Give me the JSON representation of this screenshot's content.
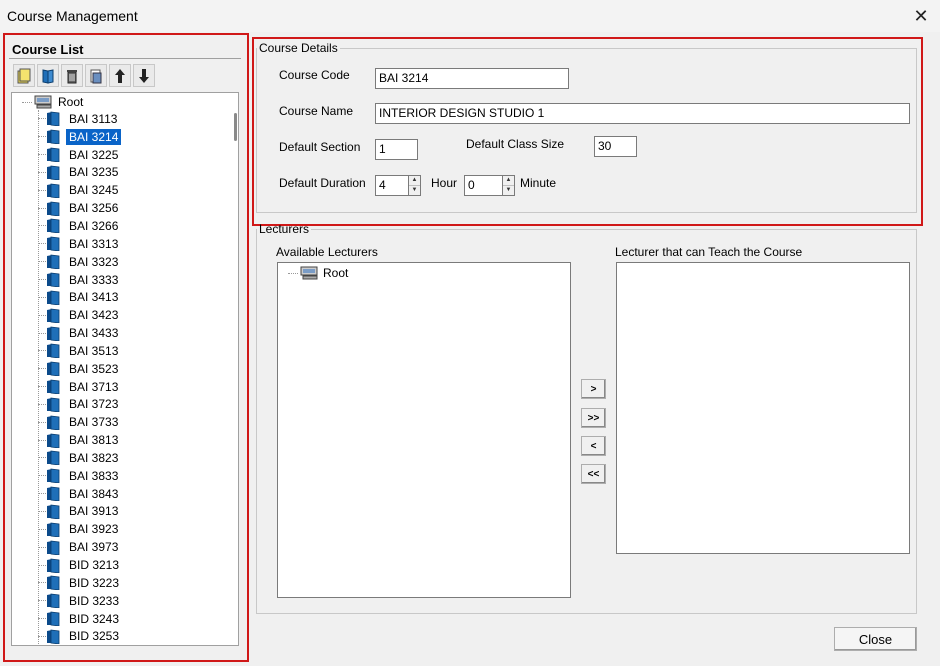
{
  "window": {
    "title": "Course Management",
    "close_glyph": "✕"
  },
  "course_list": {
    "header": "Course List",
    "toolbar": [
      {
        "icon": "new-course-icon"
      },
      {
        "icon": "edit-course-icon"
      },
      {
        "icon": "delete-course-icon"
      },
      {
        "icon": "print-icon"
      },
      {
        "icon": "move-up-icon"
      },
      {
        "icon": "move-down-icon"
      }
    ],
    "root_label": "Root",
    "selected": "BAI 3214",
    "items": [
      "BAI 3113",
      "BAI 3214",
      "BAI 3225",
      "BAI 3235",
      "BAI 3245",
      "BAI 3256",
      "BAI 3266",
      "BAI 3313",
      "BAI 3323",
      "BAI 3333",
      "BAI 3413",
      "BAI 3423",
      "BAI 3433",
      "BAI 3513",
      "BAI 3523",
      "BAI 3713",
      "BAI 3723",
      "BAI 3733",
      "BAI 3813",
      "BAI 3823",
      "BAI 3833",
      "BAI 3843",
      "BAI 3913",
      "BAI 3923",
      "BAI 3973",
      "BID 3213",
      "BID 3223",
      "BID 3233",
      "BID 3243",
      "BID 3253"
    ]
  },
  "details": {
    "legend": "Course Details",
    "course_code_label": "Course Code",
    "course_code_value": "BAI 3214",
    "course_name_label": "Course Name",
    "course_name_value": "INTERIOR DESIGN STUDIO 1",
    "default_section_label": "Default Section",
    "default_section_value": "1",
    "default_class_size_label": "Default Class Size",
    "default_class_size_value": "30",
    "default_duration_label": "Default Duration",
    "duration_hour_value": "4",
    "hour_label": "Hour",
    "duration_minute_value": "0",
    "minute_label": "Minute"
  },
  "lecturers": {
    "legend": "Lecturers",
    "available_label": "Available Lecturers",
    "available_root": "Root",
    "assigned_label": "Lecturer that can Teach the Course",
    "buttons": {
      "add": ">",
      "add_all": ">>",
      "remove": "<",
      "remove_all": "<<"
    }
  },
  "footer": {
    "close_label": "Close"
  },
  "colors": {
    "highlight": "#d01818",
    "selection": "#0a64c8",
    "book": "#1f6fb8"
  }
}
